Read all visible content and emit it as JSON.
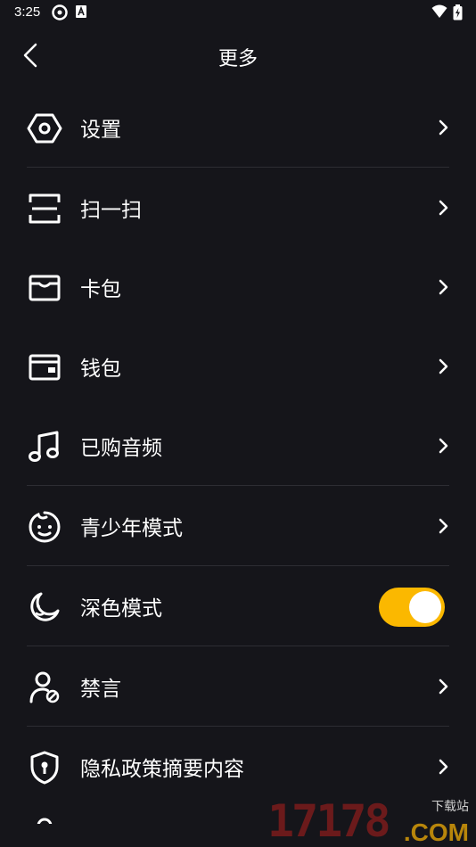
{
  "status_bar": {
    "time": "3:25"
  },
  "header": {
    "title": "更多"
  },
  "menu": {
    "items": [
      {
        "label": "设置"
      },
      {
        "label": "扫一扫"
      },
      {
        "label": "卡包"
      },
      {
        "label": "钱包"
      },
      {
        "label": "已购音频"
      },
      {
        "label": "青少年模式"
      },
      {
        "label": "深色模式",
        "toggle_on": true
      },
      {
        "label": "禁言"
      },
      {
        "label": "隐私政策摘要内容"
      }
    ]
  },
  "colors": {
    "background": "#15151a",
    "accent": "#fbb800",
    "divider": "#2d2d33"
  },
  "watermark": {
    "big": "17178",
    "small": "下载站",
    "com": ".COM"
  }
}
